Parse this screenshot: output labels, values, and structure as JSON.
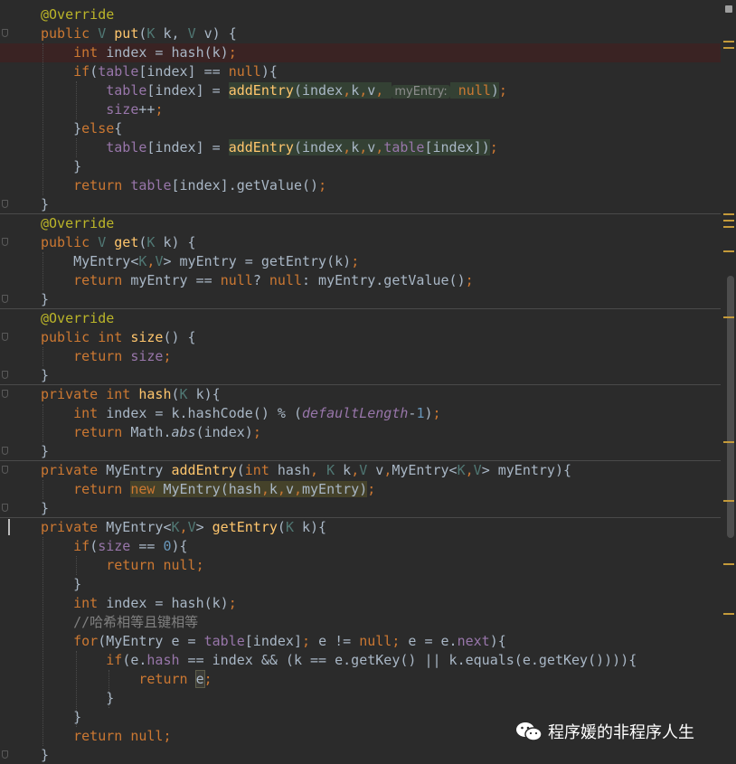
{
  "editor": {
    "lines": [
      [
        {
          "t": "@Override",
          "c": "ann"
        }
      ],
      [
        {
          "t": "public ",
          "c": "kw"
        },
        {
          "t": "V ",
          "c": "typ"
        },
        {
          "t": "put",
          "c": "fn"
        },
        {
          "t": "(",
          "c": "plain"
        },
        {
          "t": "K ",
          "c": "typ"
        },
        {
          "t": "k, ",
          "c": "plain"
        },
        {
          "t": "V ",
          "c": "typ"
        },
        {
          "t": "v) {",
          "c": "plain"
        }
      ],
      [
        {
          "t": "    "
        },
        {
          "t": "int ",
          "c": "kw"
        },
        {
          "t": "index = hash(k)",
          "c": "plain"
        },
        {
          "t": ";",
          "c": "kw"
        }
      ],
      [
        {
          "t": "    "
        },
        {
          "t": "if",
          "c": "kw"
        },
        {
          "t": "(",
          "c": "plain"
        },
        {
          "t": "table",
          "c": "fld"
        },
        {
          "t": "[index] == ",
          "c": "plain"
        },
        {
          "t": "null",
          "c": "kw"
        },
        {
          "t": "){",
          "c": "plain"
        }
      ],
      [
        {
          "t": "        "
        },
        {
          "t": "table",
          "c": "fld"
        },
        {
          "t": "[index] = ",
          "c": "plain"
        },
        {
          "t": "addEntry",
          "c": "fn",
          "m": "green"
        },
        {
          "t": "(index",
          "c": "plain",
          "m": "green"
        },
        {
          "t": ",",
          "c": "kw",
          "m": "green"
        },
        {
          "t": "k",
          "c": "plain",
          "m": "green"
        },
        {
          "t": ",",
          "c": "kw",
          "m": "green"
        },
        {
          "t": "v",
          "c": "plain",
          "m": "green"
        },
        {
          "t": ", ",
          "c": "kw",
          "m": "green"
        },
        {
          "t": "myEntry:",
          "c": "hint",
          "m": "green"
        },
        {
          "t": " ",
          "m": "green"
        },
        {
          "t": "null",
          "c": "kw",
          "m": "green"
        },
        {
          "t": ")",
          "c": "plain",
          "m": "green"
        },
        {
          "t": ";",
          "c": "kw"
        }
      ],
      [
        {
          "t": "        "
        },
        {
          "t": "size",
          "c": "fld"
        },
        {
          "t": "++",
          "c": "plain"
        },
        {
          "t": ";",
          "c": "kw"
        }
      ],
      [
        {
          "t": "    "
        },
        {
          "t": "}",
          "c": "plain"
        },
        {
          "t": "else",
          "c": "kw"
        },
        {
          "t": "{",
          "c": "plain"
        }
      ],
      [
        {
          "t": "        "
        },
        {
          "t": "table",
          "c": "fld"
        },
        {
          "t": "[index] = ",
          "c": "plain"
        },
        {
          "t": "addEntry",
          "c": "fn",
          "m": "green"
        },
        {
          "t": "(index",
          "c": "plain",
          "m": "green"
        },
        {
          "t": ",",
          "c": "kw",
          "m": "green"
        },
        {
          "t": "k",
          "c": "plain",
          "m": "green"
        },
        {
          "t": ",",
          "c": "kw",
          "m": "green"
        },
        {
          "t": "v",
          "c": "plain",
          "m": "green"
        },
        {
          "t": ",",
          "c": "kw",
          "m": "green"
        },
        {
          "t": "table",
          "c": "fld",
          "m": "green"
        },
        {
          "t": "[index]",
          "c": "plain",
          "m": "green"
        },
        {
          "t": ")",
          "c": "plain",
          "m": "green"
        },
        {
          "t": ";",
          "c": "kw"
        }
      ],
      [
        {
          "t": "    "
        },
        {
          "t": "}",
          "c": "plain"
        }
      ],
      [
        {
          "t": "    "
        },
        {
          "t": "return ",
          "c": "kw"
        },
        {
          "t": "table",
          "c": "fld"
        },
        {
          "t": "[index].getValue()",
          "c": "plain"
        },
        {
          "t": ";",
          "c": "kw"
        }
      ],
      [
        {
          "t": "}",
          "c": "plain"
        }
      ],
      [
        {
          "t": "@Override",
          "c": "ann"
        }
      ],
      [
        {
          "t": "public ",
          "c": "kw"
        },
        {
          "t": "V ",
          "c": "typ"
        },
        {
          "t": "get",
          "c": "fn"
        },
        {
          "t": "(",
          "c": "plain"
        },
        {
          "t": "K ",
          "c": "typ"
        },
        {
          "t": "k) {",
          "c": "plain"
        }
      ],
      [
        {
          "t": "    "
        },
        {
          "t": "MyEntry<",
          "c": "plain"
        },
        {
          "t": "K",
          "c": "typ"
        },
        {
          "t": ",",
          "c": "kw"
        },
        {
          "t": "V",
          "c": "typ"
        },
        {
          "t": "> myEntry = getEntry(k)",
          "c": "plain"
        },
        {
          "t": ";",
          "c": "kw"
        }
      ],
      [
        {
          "t": "    "
        },
        {
          "t": "return ",
          "c": "kw"
        },
        {
          "t": "myEntry == ",
          "c": "plain"
        },
        {
          "t": "null",
          "c": "kw"
        },
        {
          "t": "? ",
          "c": "plain"
        },
        {
          "t": "null",
          "c": "kw"
        },
        {
          "t": ": myEntry.getValue()",
          "c": "plain"
        },
        {
          "t": ";",
          "c": "kw"
        }
      ],
      [
        {
          "t": "}",
          "c": "plain"
        }
      ],
      [
        {
          "t": "@Override",
          "c": "ann"
        }
      ],
      [
        {
          "t": "public ",
          "c": "kw"
        },
        {
          "t": "int ",
          "c": "kw"
        },
        {
          "t": "size",
          "c": "fn"
        },
        {
          "t": "() {",
          "c": "plain"
        }
      ],
      [
        {
          "t": "    "
        },
        {
          "t": "return ",
          "c": "kw"
        },
        {
          "t": "size",
          "c": "fld"
        },
        {
          "t": ";",
          "c": "kw"
        }
      ],
      [
        {
          "t": "}",
          "c": "plain"
        }
      ],
      [
        {
          "t": "private ",
          "c": "kw"
        },
        {
          "t": "int ",
          "c": "kw"
        },
        {
          "t": "hash",
          "c": "fn"
        },
        {
          "t": "(",
          "c": "plain"
        },
        {
          "t": "K ",
          "c": "typ"
        },
        {
          "t": "k){",
          "c": "plain"
        }
      ],
      [
        {
          "t": "    "
        },
        {
          "t": "int ",
          "c": "kw"
        },
        {
          "t": "index = k.hashCode() % (",
          "c": "plain"
        },
        {
          "t": "defaultLength",
          "c": "fld it"
        },
        {
          "t": "-",
          "c": "plain"
        },
        {
          "t": "1",
          "c": "num"
        },
        {
          "t": ")",
          "c": "plain"
        },
        {
          "t": ";",
          "c": "kw"
        }
      ],
      [
        {
          "t": "    "
        },
        {
          "t": "return ",
          "c": "kw"
        },
        {
          "t": "Math.",
          "c": "plain"
        },
        {
          "t": "abs",
          "c": "plain it"
        },
        {
          "t": "(index)",
          "c": "plain"
        },
        {
          "t": ";",
          "c": "kw"
        }
      ],
      [
        {
          "t": "}",
          "c": "plain"
        }
      ],
      [
        {
          "t": "private ",
          "c": "kw"
        },
        {
          "t": "MyEntry ",
          "c": "plain"
        },
        {
          "t": "addEntry",
          "c": "fn"
        },
        {
          "t": "(",
          "c": "plain"
        },
        {
          "t": "int ",
          "c": "kw"
        },
        {
          "t": "hash",
          "c": "plain"
        },
        {
          "t": ", ",
          "c": "kw"
        },
        {
          "t": "K ",
          "c": "typ"
        },
        {
          "t": "k",
          "c": "plain"
        },
        {
          "t": ",",
          "c": "kw"
        },
        {
          "t": "V ",
          "c": "typ"
        },
        {
          "t": "v",
          "c": "plain"
        },
        {
          "t": ",",
          "c": "kw"
        },
        {
          "t": "MyEntry<",
          "c": "plain"
        },
        {
          "t": "K",
          "c": "typ"
        },
        {
          "t": ",",
          "c": "kw"
        },
        {
          "t": "V",
          "c": "typ"
        },
        {
          "t": "> myEntry){",
          "c": "plain"
        }
      ],
      [
        {
          "t": "    "
        },
        {
          "t": "return ",
          "c": "kw"
        },
        {
          "t": "new ",
          "c": "kw",
          "m": "olive"
        },
        {
          "t": "MyEntry",
          "c": "plain",
          "m": "olive"
        },
        {
          "t": "(hash",
          "c": "plain",
          "m": "olive"
        },
        {
          "t": ",",
          "c": "kw",
          "m": "olive"
        },
        {
          "t": "k",
          "c": "plain",
          "m": "olive"
        },
        {
          "t": ",",
          "c": "kw",
          "m": "olive"
        },
        {
          "t": "v",
          "c": "plain",
          "m": "olive"
        },
        {
          "t": ",",
          "c": "kw",
          "m": "olive"
        },
        {
          "t": "myEntry)",
          "c": "plain",
          "m": "olive"
        },
        {
          "t": ";",
          "c": "kw"
        }
      ],
      [
        {
          "t": "}",
          "c": "plain"
        }
      ],
      [
        {
          "t": "private ",
          "c": "kw"
        },
        {
          "t": "MyEntry<",
          "c": "plain"
        },
        {
          "t": "K",
          "c": "typ"
        },
        {
          "t": ",",
          "c": "kw"
        },
        {
          "t": "V",
          "c": "typ"
        },
        {
          "t": "> ",
          "c": "plain"
        },
        {
          "t": "getEntry",
          "c": "fn"
        },
        {
          "t": "(",
          "c": "plain"
        },
        {
          "t": "K ",
          "c": "typ"
        },
        {
          "t": "k){",
          "c": "plain"
        }
      ],
      [
        {
          "t": "    "
        },
        {
          "t": "if",
          "c": "kw"
        },
        {
          "t": "(",
          "c": "plain"
        },
        {
          "t": "size",
          "c": "fld"
        },
        {
          "t": " == ",
          "c": "plain"
        },
        {
          "t": "0",
          "c": "num"
        },
        {
          "t": "){",
          "c": "plain"
        }
      ],
      [
        {
          "t": "        "
        },
        {
          "t": "return ",
          "c": "kw"
        },
        {
          "t": "null",
          "c": "kw"
        },
        {
          "t": ";",
          "c": "kw"
        }
      ],
      [
        {
          "t": "    "
        },
        {
          "t": "}",
          "c": "plain"
        }
      ],
      [
        {
          "t": "    "
        },
        {
          "t": "int ",
          "c": "kw"
        },
        {
          "t": "index = hash(k)",
          "c": "plain"
        },
        {
          "t": ";",
          "c": "kw"
        }
      ],
      [
        {
          "t": "    "
        },
        {
          "t": "//哈希相等且键相等",
          "c": "cmt"
        }
      ],
      [
        {
          "t": "    "
        },
        {
          "t": "for",
          "c": "kw"
        },
        {
          "t": "(MyEntry e = ",
          "c": "plain"
        },
        {
          "t": "table",
          "c": "fld"
        },
        {
          "t": "[index]",
          "c": "plain"
        },
        {
          "t": "; ",
          "c": "kw"
        },
        {
          "t": "e != ",
          "c": "plain"
        },
        {
          "t": "null",
          "c": "kw"
        },
        {
          "t": "; ",
          "c": "kw"
        },
        {
          "t": "e = e.",
          "c": "plain"
        },
        {
          "t": "next",
          "c": "fld"
        },
        {
          "t": "){",
          "c": "plain"
        }
      ],
      [
        {
          "t": "        "
        },
        {
          "t": "if",
          "c": "kw"
        },
        {
          "t": "(e.",
          "c": "plain"
        },
        {
          "t": "hash",
          "c": "fld"
        },
        {
          "t": " == index && (k == e.getKey() || k.equals(e.getKey()))){",
          "c": "plain"
        }
      ],
      [
        {
          "t": "            "
        },
        {
          "t": "return ",
          "c": "kw"
        },
        {
          "t": "e",
          "c": "plain",
          "m": "box"
        },
        {
          "t": ";",
          "c": "kw"
        }
      ],
      [
        {
          "t": "        "
        },
        {
          "t": "}",
          "c": "plain"
        }
      ],
      [
        {
          "t": "    "
        },
        {
          "t": "}",
          "c": "plain"
        }
      ],
      [
        {
          "t": "    "
        },
        {
          "t": "return ",
          "c": "kw"
        },
        {
          "t": "null",
          "c": "kw"
        },
        {
          "t": ";",
          "c": "kw"
        }
      ],
      [
        {
          "t": "}",
          "c": "plain"
        }
      ]
    ]
  },
  "watermark": {
    "text": "程序媛的非程序人生",
    "icon": "wechat-icon"
  }
}
